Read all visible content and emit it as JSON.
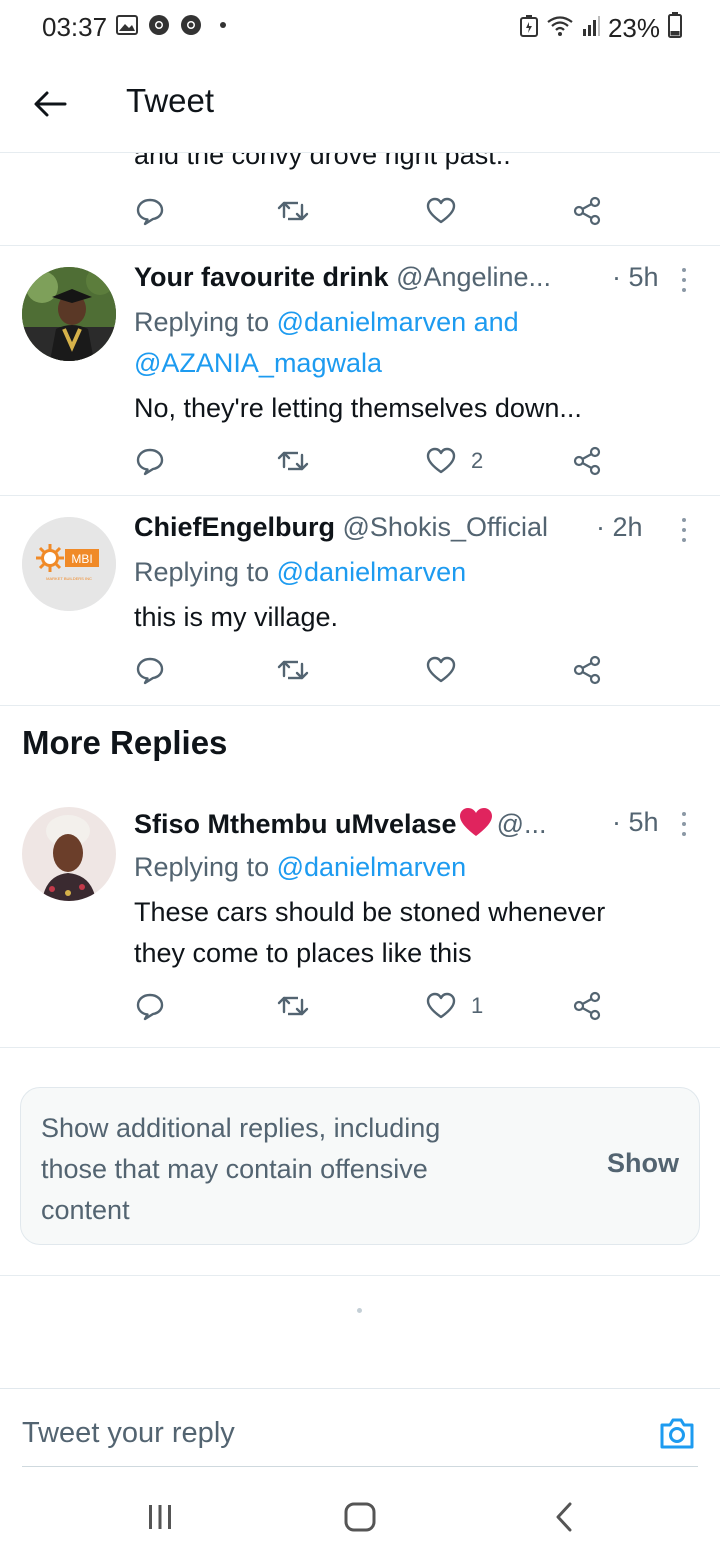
{
  "status_bar": {
    "time": "03:37",
    "left_icons": [
      "gallery-icon",
      "chrome-icon",
      "chrome-icon",
      "dot-icon"
    ],
    "battery": "23%",
    "right_icons": [
      "battery-saver-icon",
      "wifi-icon",
      "signal-icon",
      "battery-icon"
    ]
  },
  "header": {
    "title": "Tweet",
    "back_icon": "arrow-left-icon"
  },
  "clipped_tweet": {
    "text": "and the convy drove right past.."
  },
  "tweets": [
    {
      "name": "Your favourite drink",
      "handle": "@Angeline...",
      "time": "· 5h",
      "replying_label": "Replying to",
      "mentions_line1": "@danielmarven and",
      "mentions_line2": "@AZANIA_magwala",
      "body": "No, they're letting themselves down...",
      "likes": "2"
    },
    {
      "name": "ChiefEngelburg",
      "handle": "@Shokis_Official",
      "time": "· 2h",
      "replying_label": "Replying to",
      "mentions_line1": "@danielmarven",
      "body": "this is my village.",
      "likes": "",
      "avatar_text": "MBI",
      "avatar_subtext": "MARKET BUILDERS INC"
    },
    {
      "name": "Sfiso Mthembu uMvelase",
      "handle": "@...",
      "time": "· 5h",
      "replying_label": "Replying to",
      "mentions_line1": "@danielmarven",
      "body_line1": "These cars should be stoned whenever",
      "body_line2": "they come to places like this",
      "likes": "1"
    }
  ],
  "more_replies": {
    "title": "More Replies"
  },
  "additional_replies": {
    "text": "Show additional replies, including those that may contain offensive content",
    "button": "Show"
  },
  "composer": {
    "placeholder": "Tweet your reply",
    "camera_icon": "camera-icon"
  },
  "nav": {
    "recent_icon": "recent-apps-icon",
    "home_icon": "home-icon",
    "back_icon": "back-chevron-icon"
  },
  "colors": {
    "accent": "#1d9bf0",
    "secondary_text": "#536471",
    "primary_text": "#0f1419",
    "divider": "#e6ecf0",
    "heart": "#e0245e"
  }
}
